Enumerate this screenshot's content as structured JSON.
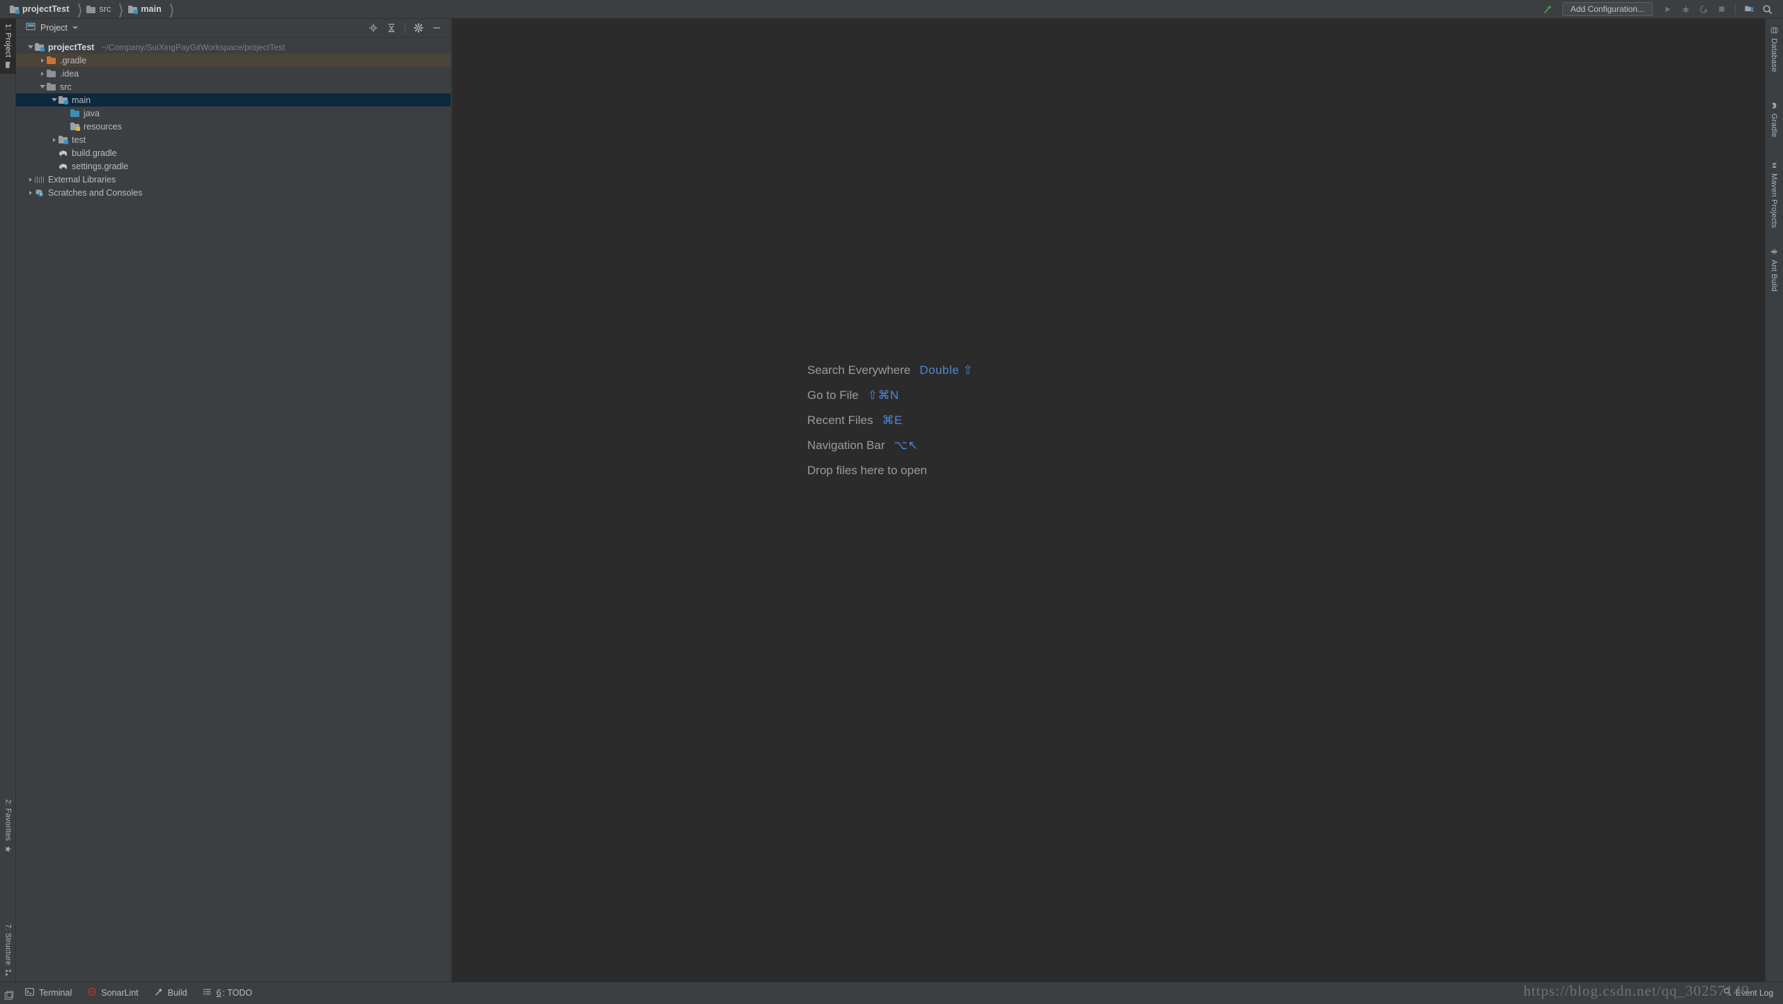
{
  "breadcrumb": [
    {
      "label": "projectTest",
      "icon": "module-folder-icon",
      "bold": true
    },
    {
      "label": "src",
      "icon": "folder-icon",
      "bold": false
    },
    {
      "label": "main",
      "icon": "module-folder-icon",
      "bold": true
    }
  ],
  "toolbar": {
    "build_icon": "hammer-icon",
    "add_configuration": "Add Configuration...",
    "run_icon": "run-icon",
    "debug_icon": "debug-icon",
    "run_coverage_icon": "run-with-coverage-icon",
    "stop_icon": "stop-icon",
    "project_structure_icon": "project-structure-icon",
    "search_icon": "search-icon"
  },
  "left_tabs": [
    {
      "label": "1: Project",
      "icon": "project-icon",
      "active": true
    },
    {
      "label": "2: Favorites",
      "icon": "star-icon",
      "active": false
    },
    {
      "label": "7: Structure",
      "icon": "structure-icon",
      "active": false
    }
  ],
  "right_tabs": [
    {
      "label": "Database",
      "icon": "database-icon"
    },
    {
      "label": "Gradle",
      "icon": "gradle-elephant-icon"
    },
    {
      "label": "Maven Projects",
      "icon": "maven-icon"
    },
    {
      "label": "Ant Build",
      "icon": "ant-icon"
    }
  ],
  "project_panel": {
    "title": "Project",
    "dropdown_icon": "chevron-down-icon",
    "tools": [
      {
        "name": "select-opened-file-icon",
        "title": "Select Opened File"
      },
      {
        "name": "collapse-all-icon",
        "title": "Collapse All"
      },
      {
        "name": "gear-icon",
        "title": "Settings"
      },
      {
        "name": "hide-icon",
        "title": "Hide"
      }
    ],
    "tree": [
      {
        "label": "projectTest",
        "path": "~/Company/SuiXingPayGitWorkspace/projectTest",
        "indent": 0,
        "arrow": "open",
        "icon": "module-folder-icon",
        "state": "normal",
        "bold": true
      },
      {
        "label": ".gradle",
        "path": "",
        "indent": 1,
        "arrow": "closed",
        "icon": "folder-orange-icon",
        "state": "highlight",
        "bold": false
      },
      {
        "label": ".idea",
        "path": "",
        "indent": 1,
        "arrow": "closed",
        "icon": "folder-icon",
        "state": "normal",
        "bold": false
      },
      {
        "label": "src",
        "path": "",
        "indent": 1,
        "arrow": "open",
        "icon": "folder-icon",
        "state": "normal",
        "bold": false
      },
      {
        "label": "main",
        "path": "",
        "indent": 2,
        "arrow": "open",
        "icon": "module-folder-icon",
        "state": "selected",
        "bold": false
      },
      {
        "label": "java",
        "path": "",
        "indent": 3,
        "arrow": "none",
        "icon": "folder-blue-icon",
        "state": "normal",
        "bold": false
      },
      {
        "label": "resources",
        "path": "",
        "indent": 3,
        "arrow": "none",
        "icon": "resources-folder-icon",
        "state": "normal",
        "bold": false
      },
      {
        "label": "test",
        "path": "",
        "indent": 2,
        "arrow": "closed",
        "icon": "module-folder-icon",
        "state": "normal",
        "bold": false
      },
      {
        "label": "build.gradle",
        "path": "",
        "indent": 2,
        "arrow": "none",
        "icon": "gradle-file-icon",
        "state": "normal",
        "bold": false
      },
      {
        "label": "settings.gradle",
        "path": "",
        "indent": 2,
        "arrow": "none",
        "icon": "gradle-file-icon",
        "state": "normal",
        "bold": false
      },
      {
        "label": "External Libraries",
        "path": "",
        "indent": 0,
        "arrow": "closed",
        "icon": "libraries-icon",
        "state": "normal",
        "bold": false
      },
      {
        "label": "Scratches and Consoles",
        "path": "",
        "indent": 0,
        "arrow": "closed",
        "icon": "scratches-icon",
        "state": "normal",
        "bold": false
      }
    ]
  },
  "editor_hints": [
    {
      "label": "Search Everywhere",
      "key": "Double ⇧"
    },
    {
      "label": "Go to File",
      "key": "⇧⌘N"
    },
    {
      "label": "Recent Files",
      "key": "⌘E"
    },
    {
      "label": "Navigation Bar",
      "key": "⌥↖"
    },
    {
      "label": "Drop files here to open",
      "key": ""
    }
  ],
  "statusbar": {
    "items": [
      {
        "label": "Terminal",
        "icon": "terminal-icon",
        "mnemonic": ""
      },
      {
        "label": "SonarLint",
        "icon": "sonarlint-icon",
        "mnemonic": ""
      },
      {
        "label": "Build",
        "icon": "build-hammer-icon",
        "mnemonic": ""
      },
      {
        "label": ": TODO",
        "icon": "todo-icon",
        "mnemonic": "6"
      }
    ],
    "event_log": "Event Log",
    "event_log_icon": "search-icon"
  },
  "watermark": "https://blog.csdn.net/qq_30257149",
  "colors": {
    "panel_bg": "#3c3f41",
    "editor_bg": "#2b2b2b",
    "selection": "#0d293e",
    "highlight": "#4b4439",
    "accent_blue": "#4f86d6",
    "module_badge": "#3592c4",
    "text": "#bbbbbb"
  }
}
